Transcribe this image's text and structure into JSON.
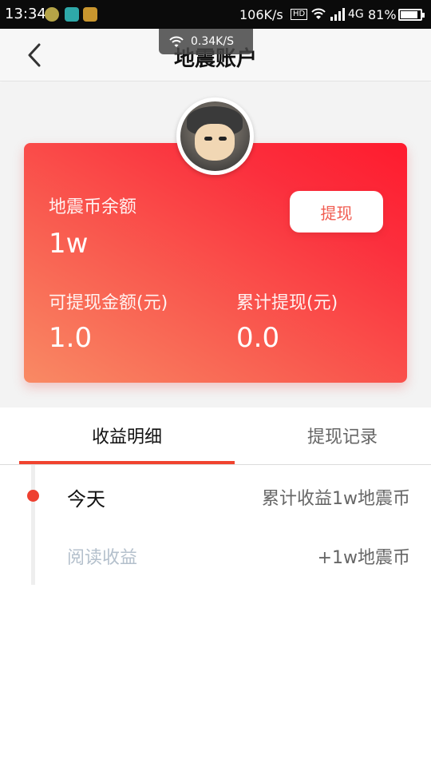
{
  "status_bar": {
    "time": "13:34",
    "net_speed": "106K/s",
    "hd": "HD",
    "network_type": "4G",
    "battery_pct": "81%",
    "battery_level": 0.81
  },
  "network_toast": {
    "speed": "0.34K/S"
  },
  "header": {
    "title": "地震账户"
  },
  "account_card": {
    "balance_label": "地震币余额",
    "balance_value": "1w",
    "withdraw_label": "提现",
    "available_label": "可提现金额(元)",
    "available_value": "1.0",
    "total_withdrawn_label": "累计提现(元)",
    "total_withdrawn_value": "0.0"
  },
  "tabs": [
    {
      "label": "收益明细",
      "active": true
    },
    {
      "label": "提现记录",
      "active": false
    }
  ],
  "timeline": {
    "day_label": "今天",
    "day_summary": "累计收益1w地震币",
    "items": [
      {
        "label": "阅读收益",
        "amount": "+1w地震币"
      }
    ]
  },
  "colors": {
    "accent": "#f0432f",
    "card_gradient_start": "#f98a64",
    "card_gradient_end": "#ff1b2e"
  },
  "icons": {
    "back": "chevron-left-icon",
    "wifi": "wifi-icon",
    "signal": "signal-icon",
    "battery": "battery-icon"
  }
}
